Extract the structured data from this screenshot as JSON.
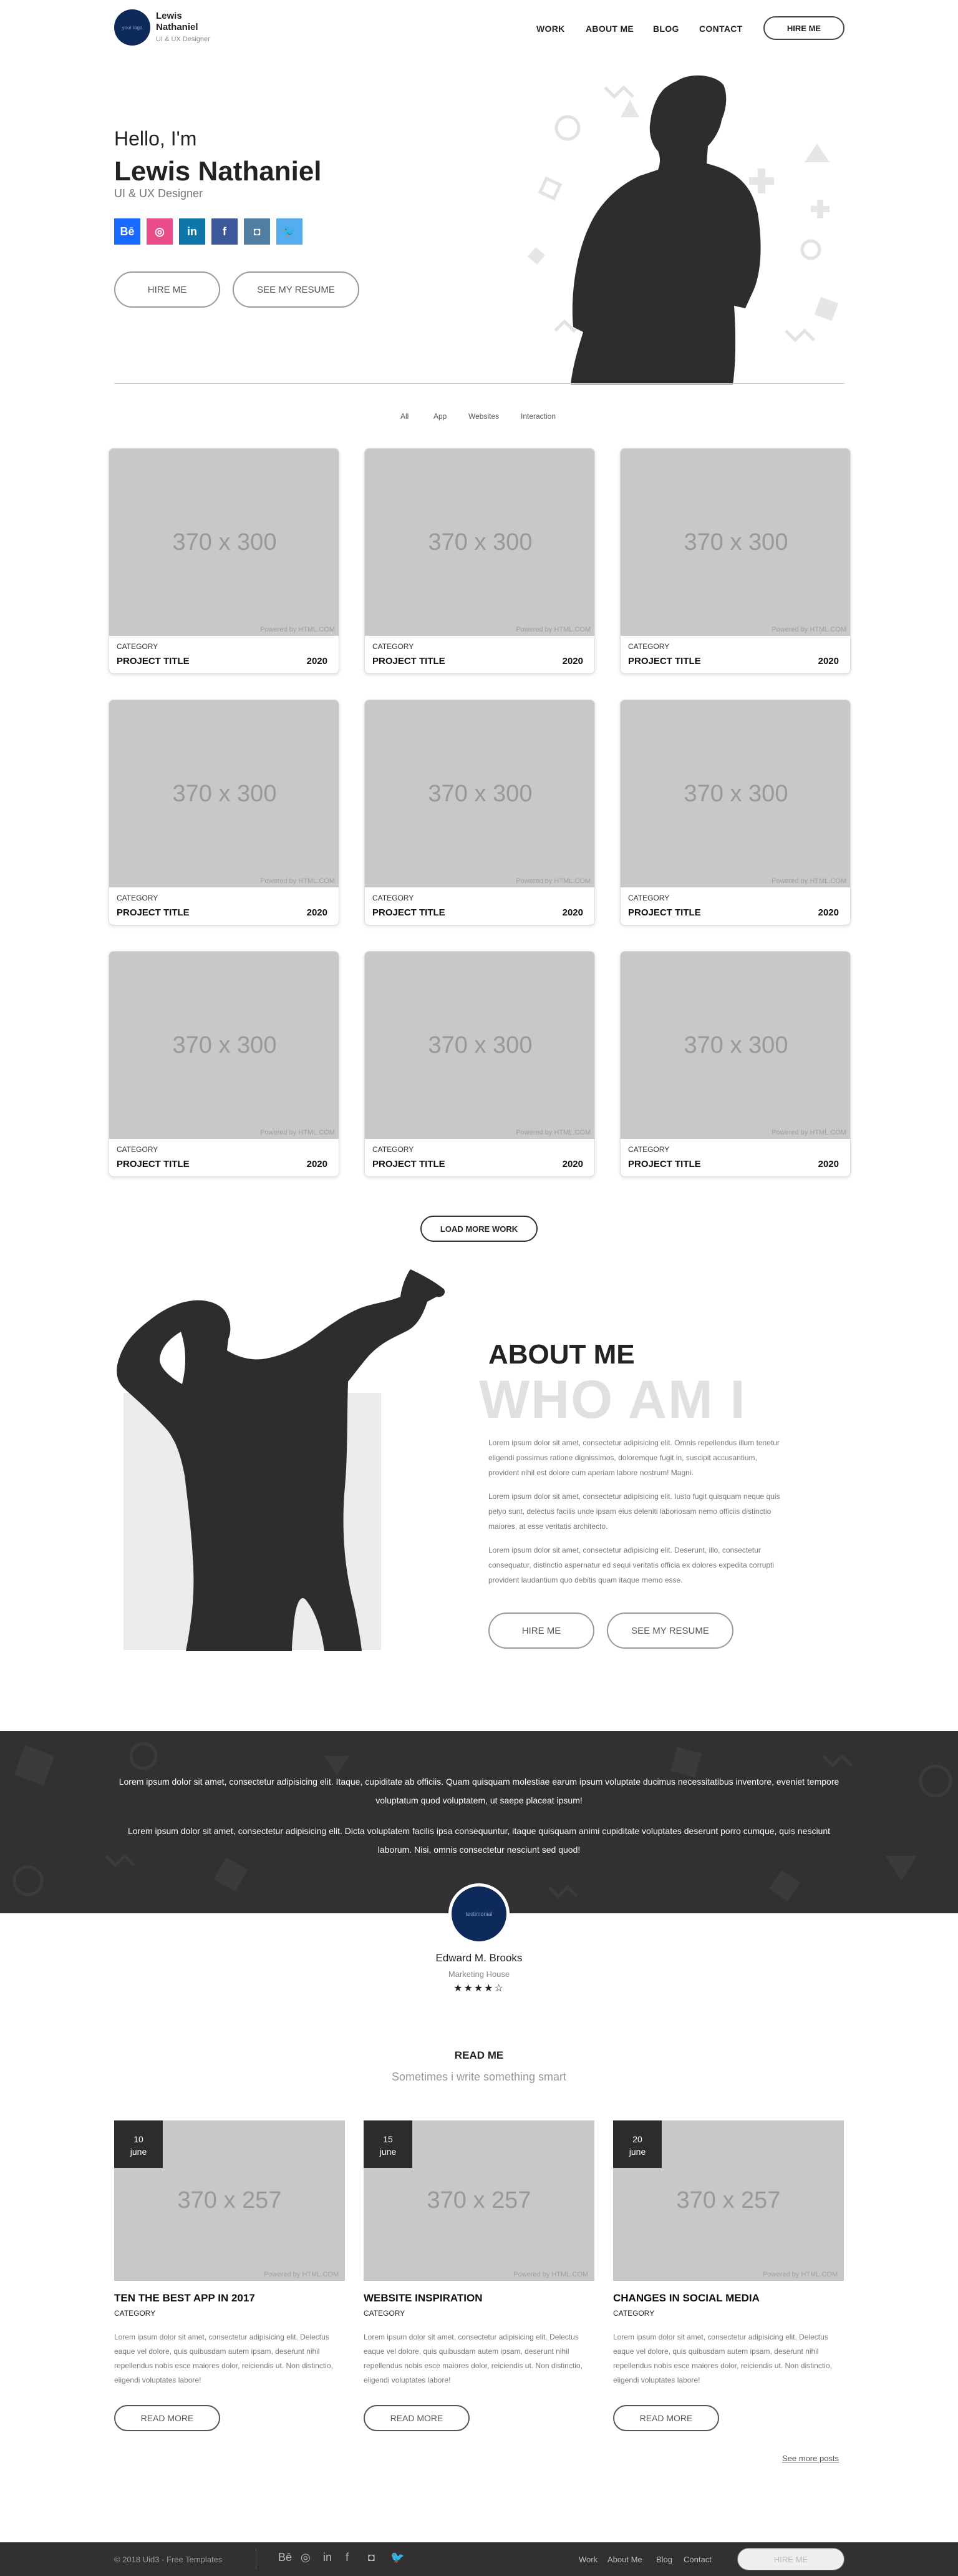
{
  "header": {
    "logo_text": "your logo",
    "name": "Lewis Nathaniel",
    "subtitle": "UI & UX Designer",
    "nav": [
      "WORK",
      "ABOUT ME",
      "BLOG",
      "CONTACT"
    ],
    "hire_label": "HIRE ME"
  },
  "hero": {
    "greeting": "Hello, I'm",
    "name": "Lewis Nathaniel",
    "role": "UI & UX Designer",
    "social": [
      {
        "icon": "behance-icon",
        "glyph": "Bē",
        "color": "#1769ff"
      },
      {
        "icon": "dribbble-icon",
        "glyph": "◎",
        "color": "#ea4c89"
      },
      {
        "icon": "linkedin-icon",
        "glyph": "in",
        "color": "#0e76a8"
      },
      {
        "icon": "facebook-icon",
        "glyph": "f",
        "color": "#3b5998"
      },
      {
        "icon": "instagram-icon",
        "glyph": "◘",
        "color": "#517fa4"
      },
      {
        "icon": "twitter-icon",
        "glyph": "🐦",
        "color": "#55acee"
      }
    ],
    "hire_label": "HIRE ME",
    "resume_label": "SEE MY RESUME"
  },
  "filters": [
    "All",
    "App",
    "Websites",
    "Interaction"
  ],
  "projects": [
    {
      "placeholder": "370 x 300",
      "powered": "Powered by HTML.COM",
      "category": "CATEGORY",
      "title": "PROJECT TITLE",
      "year": "2020"
    },
    {
      "placeholder": "370 x 300",
      "powered": "Powered by HTML.COM",
      "category": "CATEGORY",
      "title": "PROJECT TITLE",
      "year": "2020"
    },
    {
      "placeholder": "370 x 300",
      "powered": "Powered by HTML.COM",
      "category": "CATEGORY",
      "title": "PROJECT TITLE",
      "year": "2020"
    },
    {
      "placeholder": "370 x 300",
      "powered": "Powered by HTML.COM",
      "category": "CATEGORY",
      "title": "PROJECT TITLE",
      "year": "2020"
    },
    {
      "placeholder": "370 x 300",
      "powered": "Powered by HTML.COM",
      "category": "CATEGORY",
      "title": "PROJECT TITLE",
      "year": "2020"
    },
    {
      "placeholder": "370 x 300",
      "powered": "Powered by HTML.COM",
      "category": "CATEGORY",
      "title": "PROJECT TITLE",
      "year": "2020"
    },
    {
      "placeholder": "370 x 300",
      "powered": "Powered by HTML.COM",
      "category": "CATEGORY",
      "title": "PROJECT TITLE",
      "year": "2020"
    },
    {
      "placeholder": "370 x 300",
      "powered": "Powered by HTML.COM",
      "category": "CATEGORY",
      "title": "PROJECT TITLE",
      "year": "2020"
    },
    {
      "placeholder": "370 x 300",
      "powered": "Powered by HTML.COM",
      "category": "CATEGORY",
      "title": "PROJECT TITLE",
      "year": "2020"
    }
  ],
  "load_more_label": "LOAD MORE WORK",
  "about": {
    "title": "ABOUT ME",
    "watermark": "WHO AM I",
    "paragraphs": [
      "Lorem ipsum dolor sit amet, consectetur adipisicing elit. Omnis repellendus illum tenetur eligendi possimus ratione dignissimos, doloremque fugit in, suscipit accusantium, provident nihil est dolore cum aperiam labore nostrum! Magni.",
      "Lorem ipsum dolor sit amet, consectetur adipisicing elit. Iusto fugit quisquam neque quis pelyo sunt, delectus facilis unde ipsam eius deleniti laboriosam nemo officiis distinctio maiores, at esse veritatis architecto.",
      "Lorem ipsum dolor sit amet, consectetur adipisicing elit. Deserunt, illo, consectetur consequatur, distinctio aspernatur ed sequi veritatis officia ex dolores expedita corrupti provident laudantium quo debitis quam itaque rnemo esse."
    ],
    "hire_label": "HIRE ME",
    "resume_label": "SEE MY RESUME"
  },
  "testimonial": {
    "quote_1": "Lorem ipsum dolor sit amet, consectetur adipisicing elit. Itaque, cupiditate ab officiis. Quam quisquam molestiae earum ipsum voluptate ducimus necessitatibus inventore, eveniet tempore voluptatum quod voluptatem, ut saepe placeat ipsum!",
    "quote_2": "Lorem ipsum dolor sit amet, consectetur adipisicing elit. Dicta voluptatem facilis ipsa consequuntur, itaque quisquam animi cupiditate voluptates deserunt porro cumque, quis nesciunt laborum. Nisi, omnis consectetur nesciunt sed quod!",
    "avatar_text": "testimonial",
    "name": "Edward M. Brooks",
    "company": "Marketing House",
    "stars": "★★★★☆"
  },
  "blog": {
    "title": "READ ME",
    "subtitle": "Sometimes i write something smart",
    "posts": [
      {
        "day": "10",
        "month": "june",
        "placeholder": "370 x 257",
        "powered": "Powered by HTML.COM",
        "title": "TEN THE BEST APP IN 2017",
        "category": "CATEGORY",
        "excerpt": "Lorem ipsum dolor sit amet, consectetur adipisicing elit. Delectus eaque vel dolore, quis quibusdam autem ipsam, deserunt nihil repellendus nobis esce maiores dolor, reiciendis ut. Non distinctio, eligendi voluptates labore!",
        "button": "READ MORE"
      },
      {
        "day": "15",
        "month": "june",
        "placeholder": "370 x 257",
        "powered": "Powered by HTML.COM",
        "title": "WEBSITE INSPIRATION",
        "category": "CATEGORY",
        "excerpt": "Lorem ipsum dolor sit amet, consectetur adipisicing elit. Delectus eaque vel dolore, quis quibusdam autem ipsam, deserunt nihil repellendus nobis esce maiores dolor, reiciendis ut. Non distinctio, eligendi voluptates labore!",
        "button": "READ MORE"
      },
      {
        "day": "20",
        "month": "june",
        "placeholder": "370 x 257",
        "powered": "Powered by HTML.COM",
        "title": "CHANGES IN SOCIAL MEDIA",
        "category": "CATEGORY",
        "excerpt": "Lorem ipsum dolor sit amet, consectetur adipisicing elit. Delectus eaque vel dolore, quis quibusdam autem ipsam, deserunt nihil repellendus nobis esce maiores dolor, reiciendis ut. Non distinctio, eligendi voluptates labore!",
        "button": "READ MORE"
      }
    ],
    "see_more": "See more posts"
  },
  "footer": {
    "copyright": "© 2018 Uid3 - Free Templates",
    "icons": [
      {
        "icon": "behance-icon",
        "glyph": "Bē"
      },
      {
        "icon": "dribbble-icon",
        "glyph": "◎"
      },
      {
        "icon": "linkedin-icon",
        "glyph": "in"
      },
      {
        "icon": "facebook-icon",
        "glyph": "f"
      },
      {
        "icon": "instagram-icon",
        "glyph": "◘"
      },
      {
        "icon": "twitter-icon",
        "glyph": "🐦"
      }
    ],
    "links": [
      "Work",
      "About Me",
      "Blog",
      "Contact"
    ],
    "hire_label": "HIRE ME"
  }
}
